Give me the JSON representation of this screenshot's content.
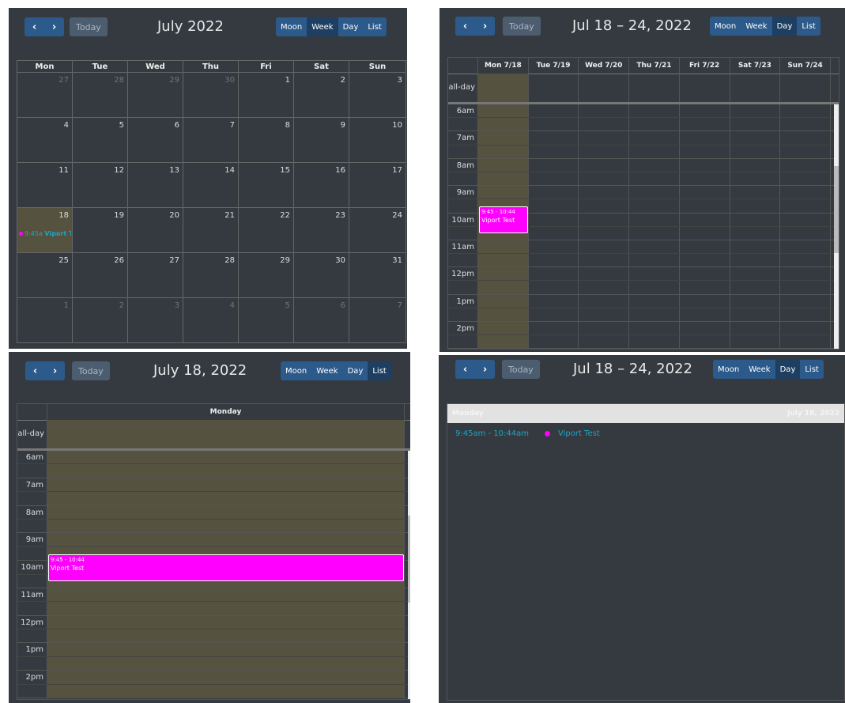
{
  "nav": {
    "prev_icon": "‹",
    "next_icon": "›",
    "today_label": "Today"
  },
  "views": {
    "month": "Moon",
    "week": "Week",
    "day": "Day",
    "list": "List"
  },
  "colors": {
    "event": "#ff00ff",
    "today_bg": "#55523f",
    "panel_bg": "#343a40",
    "event_text": "#1ea5c6"
  },
  "month_view": {
    "title": "July 2022",
    "weekdays": [
      "Mon",
      "Tue",
      "Wed",
      "Thu",
      "Fri",
      "Sat",
      "Sun"
    ],
    "weeks": [
      [
        "27",
        "28",
        "29",
        "30",
        "1",
        "2",
        "3"
      ],
      [
        "4",
        "5",
        "6",
        "7",
        "8",
        "9",
        "10"
      ],
      [
        "11",
        "12",
        "13",
        "14",
        "15",
        "16",
        "17"
      ],
      [
        "18",
        "19",
        "20",
        "21",
        "22",
        "23",
        "24"
      ],
      [
        "25",
        "26",
        "27",
        "28",
        "29",
        "30",
        "31"
      ],
      [
        "1",
        "2",
        "3",
        "4",
        "5",
        "6",
        "7"
      ]
    ],
    "event": {
      "time": "9:45a",
      "title": "Viport Te"
    }
  },
  "week_view": {
    "title": "Jul 18 – 24, 2022",
    "columns": [
      "Mon 7/18",
      "Tue 7/19",
      "Wed 7/20",
      "Thu 7/21",
      "Fri 7/22",
      "Sat 7/23",
      "Sun 7/24"
    ],
    "allday_label": "all-day",
    "hours": [
      "6am",
      "7am",
      "8am",
      "9am",
      "10am",
      "11am",
      "12pm",
      "1pm",
      "2pm"
    ],
    "event": {
      "time": "9:45 - 10:44",
      "title": "Viport Test"
    }
  },
  "day_view": {
    "title": "July 18, 2022",
    "column": "Monday",
    "allday_label": "all-day",
    "hours": [
      "6am",
      "7am",
      "8am",
      "9am",
      "10am",
      "11am",
      "12pm",
      "1pm",
      "2pm"
    ],
    "event": {
      "time": "9:45 - 10:44",
      "title": "Viport Test"
    }
  },
  "list_view": {
    "title": "Jul 18 – 24, 2022",
    "day_name": "Monday",
    "day_date": "July 18, 2022",
    "event": {
      "time": "9:45am - 10:44am",
      "title": "Viport Test"
    }
  }
}
